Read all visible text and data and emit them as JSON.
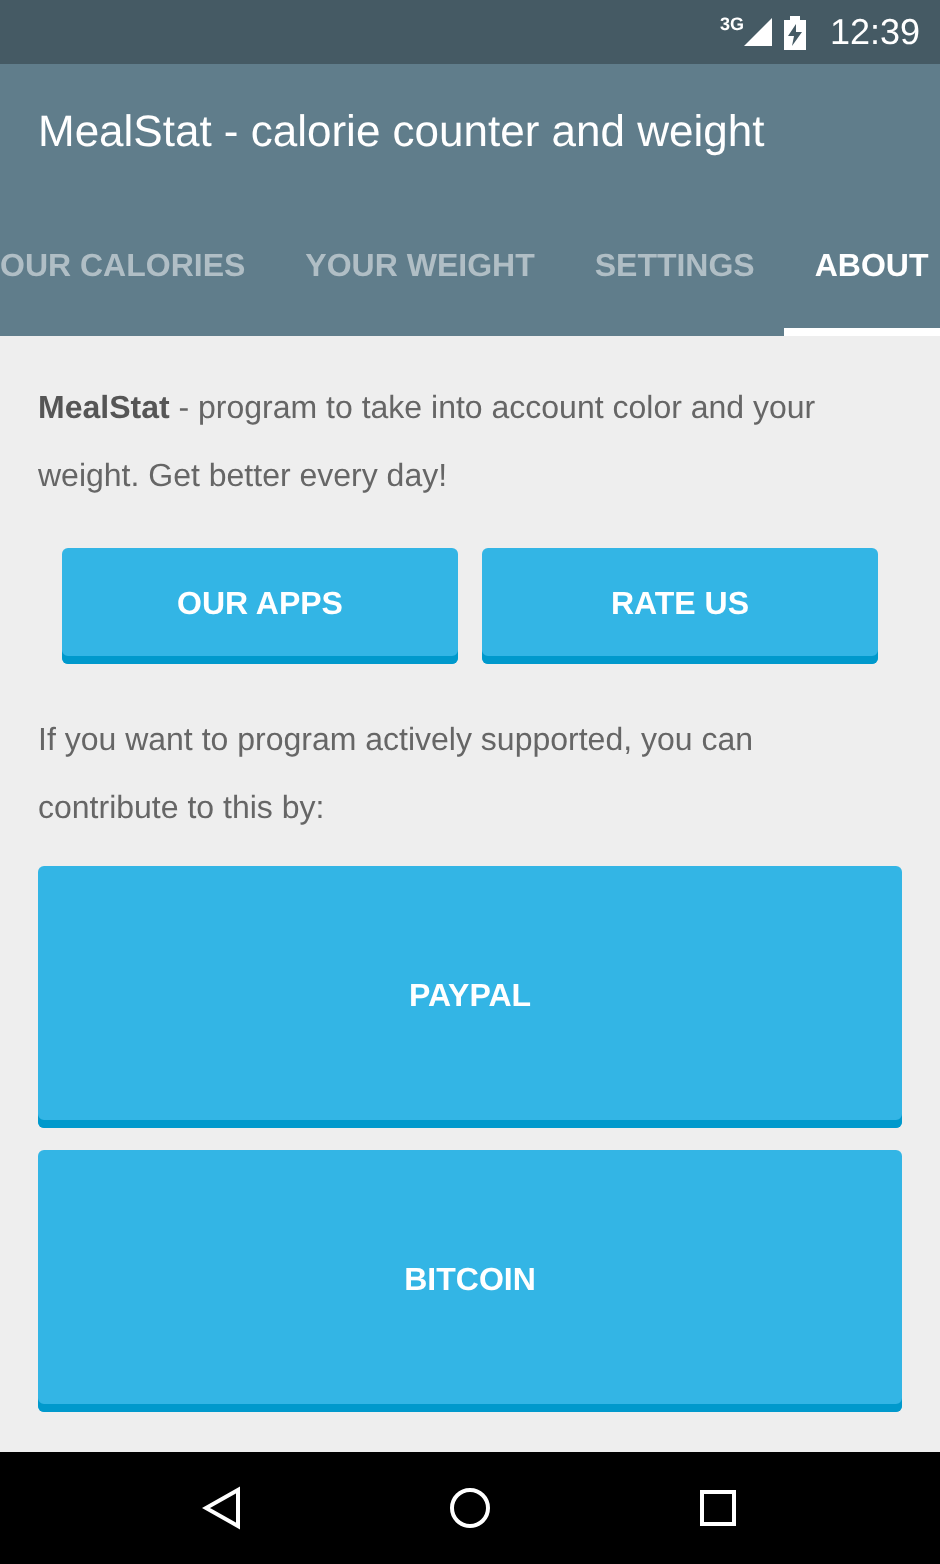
{
  "status_bar": {
    "network": "3G",
    "time": "12:39"
  },
  "app_bar": {
    "title": "MealStat - calorie counter and weight"
  },
  "tabs": [
    {
      "label": "OUR CALORIES",
      "selected": false
    },
    {
      "label": "YOUR WEIGHT",
      "selected": false
    },
    {
      "label": "SETTINGS",
      "selected": false
    },
    {
      "label": "ABOUT",
      "selected": true
    }
  ],
  "about": {
    "description": "**MealStat** - program to take into account color and your weight. Get better every day!",
    "buttons": [
      "OUR APPS",
      "RATE US"
    ],
    "support_text": "If you want to program actively supported, you can contribute to this by:",
    "donate_buttons": [
      "PAYPAL",
      "BITCOIN"
    ]
  }
}
